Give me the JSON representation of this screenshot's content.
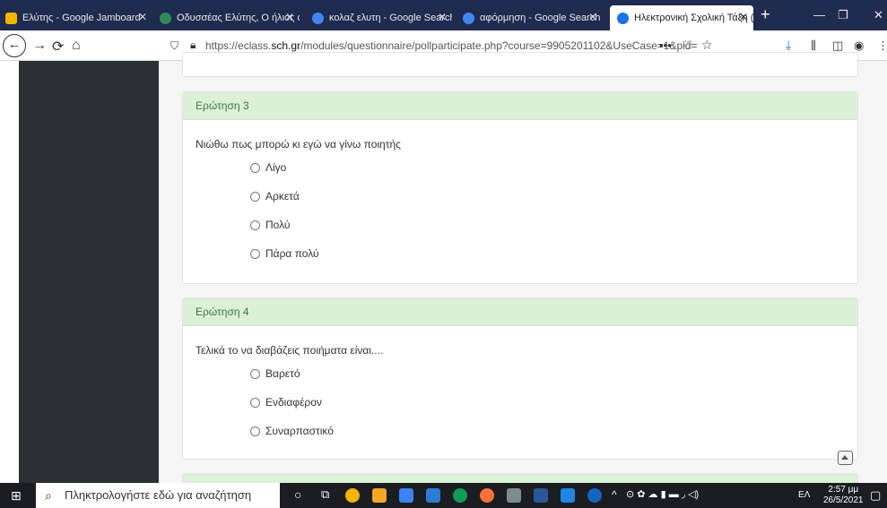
{
  "tabs": [
    {
      "label": "Ελύτης - Google Jamboard",
      "icon": "jamboard-icon",
      "color": "#f4b400"
    },
    {
      "label": "Οδυσσέας Ελύτης, Ο ήλιος ο",
      "icon": "site-icon",
      "color": "#2e8b57"
    },
    {
      "label": "κολαζ ελυτη - Google Search",
      "icon": "google-icon",
      "color": "#4285f4"
    },
    {
      "label": "αφόρμηση - Google Search",
      "icon": "google-icon",
      "color": "#4285f4"
    },
    {
      "label": "Ηλεκτρονική Σχολική Τάξη (",
      "icon": "eclass-icon",
      "color": "#1a73e8"
    }
  ],
  "url": {
    "prefix": "https://eclass.",
    "domain": "sch.gr",
    "path": "/modules/questionnaire/pollparticipate.php?course=9905201102&UseCase=1&pid="
  },
  "questions": [
    {
      "header": "Ερώτηση 3",
      "text": "Νιώθω πως μπορώ κι εγώ να γίνω ποιητής",
      "options": [
        "Λίγο",
        "Αρκετά",
        "Πολύ",
        "Πάρα πολύ"
      ]
    },
    {
      "header": "Ερώτηση 4",
      "text": "Τελικά το να διαβάζεις ποιήματα είναι....",
      "options": [
        "Βαρετό",
        "Ενδιαφέρον",
        "Συναρπαστικό"
      ]
    }
  ],
  "taskbar": {
    "search_placeholder": "Πληκτρολογήστε εδώ για αναζήτηση",
    "lang": "ΕΛ",
    "time": "2:57 μμ",
    "date": "26/5/2021"
  }
}
